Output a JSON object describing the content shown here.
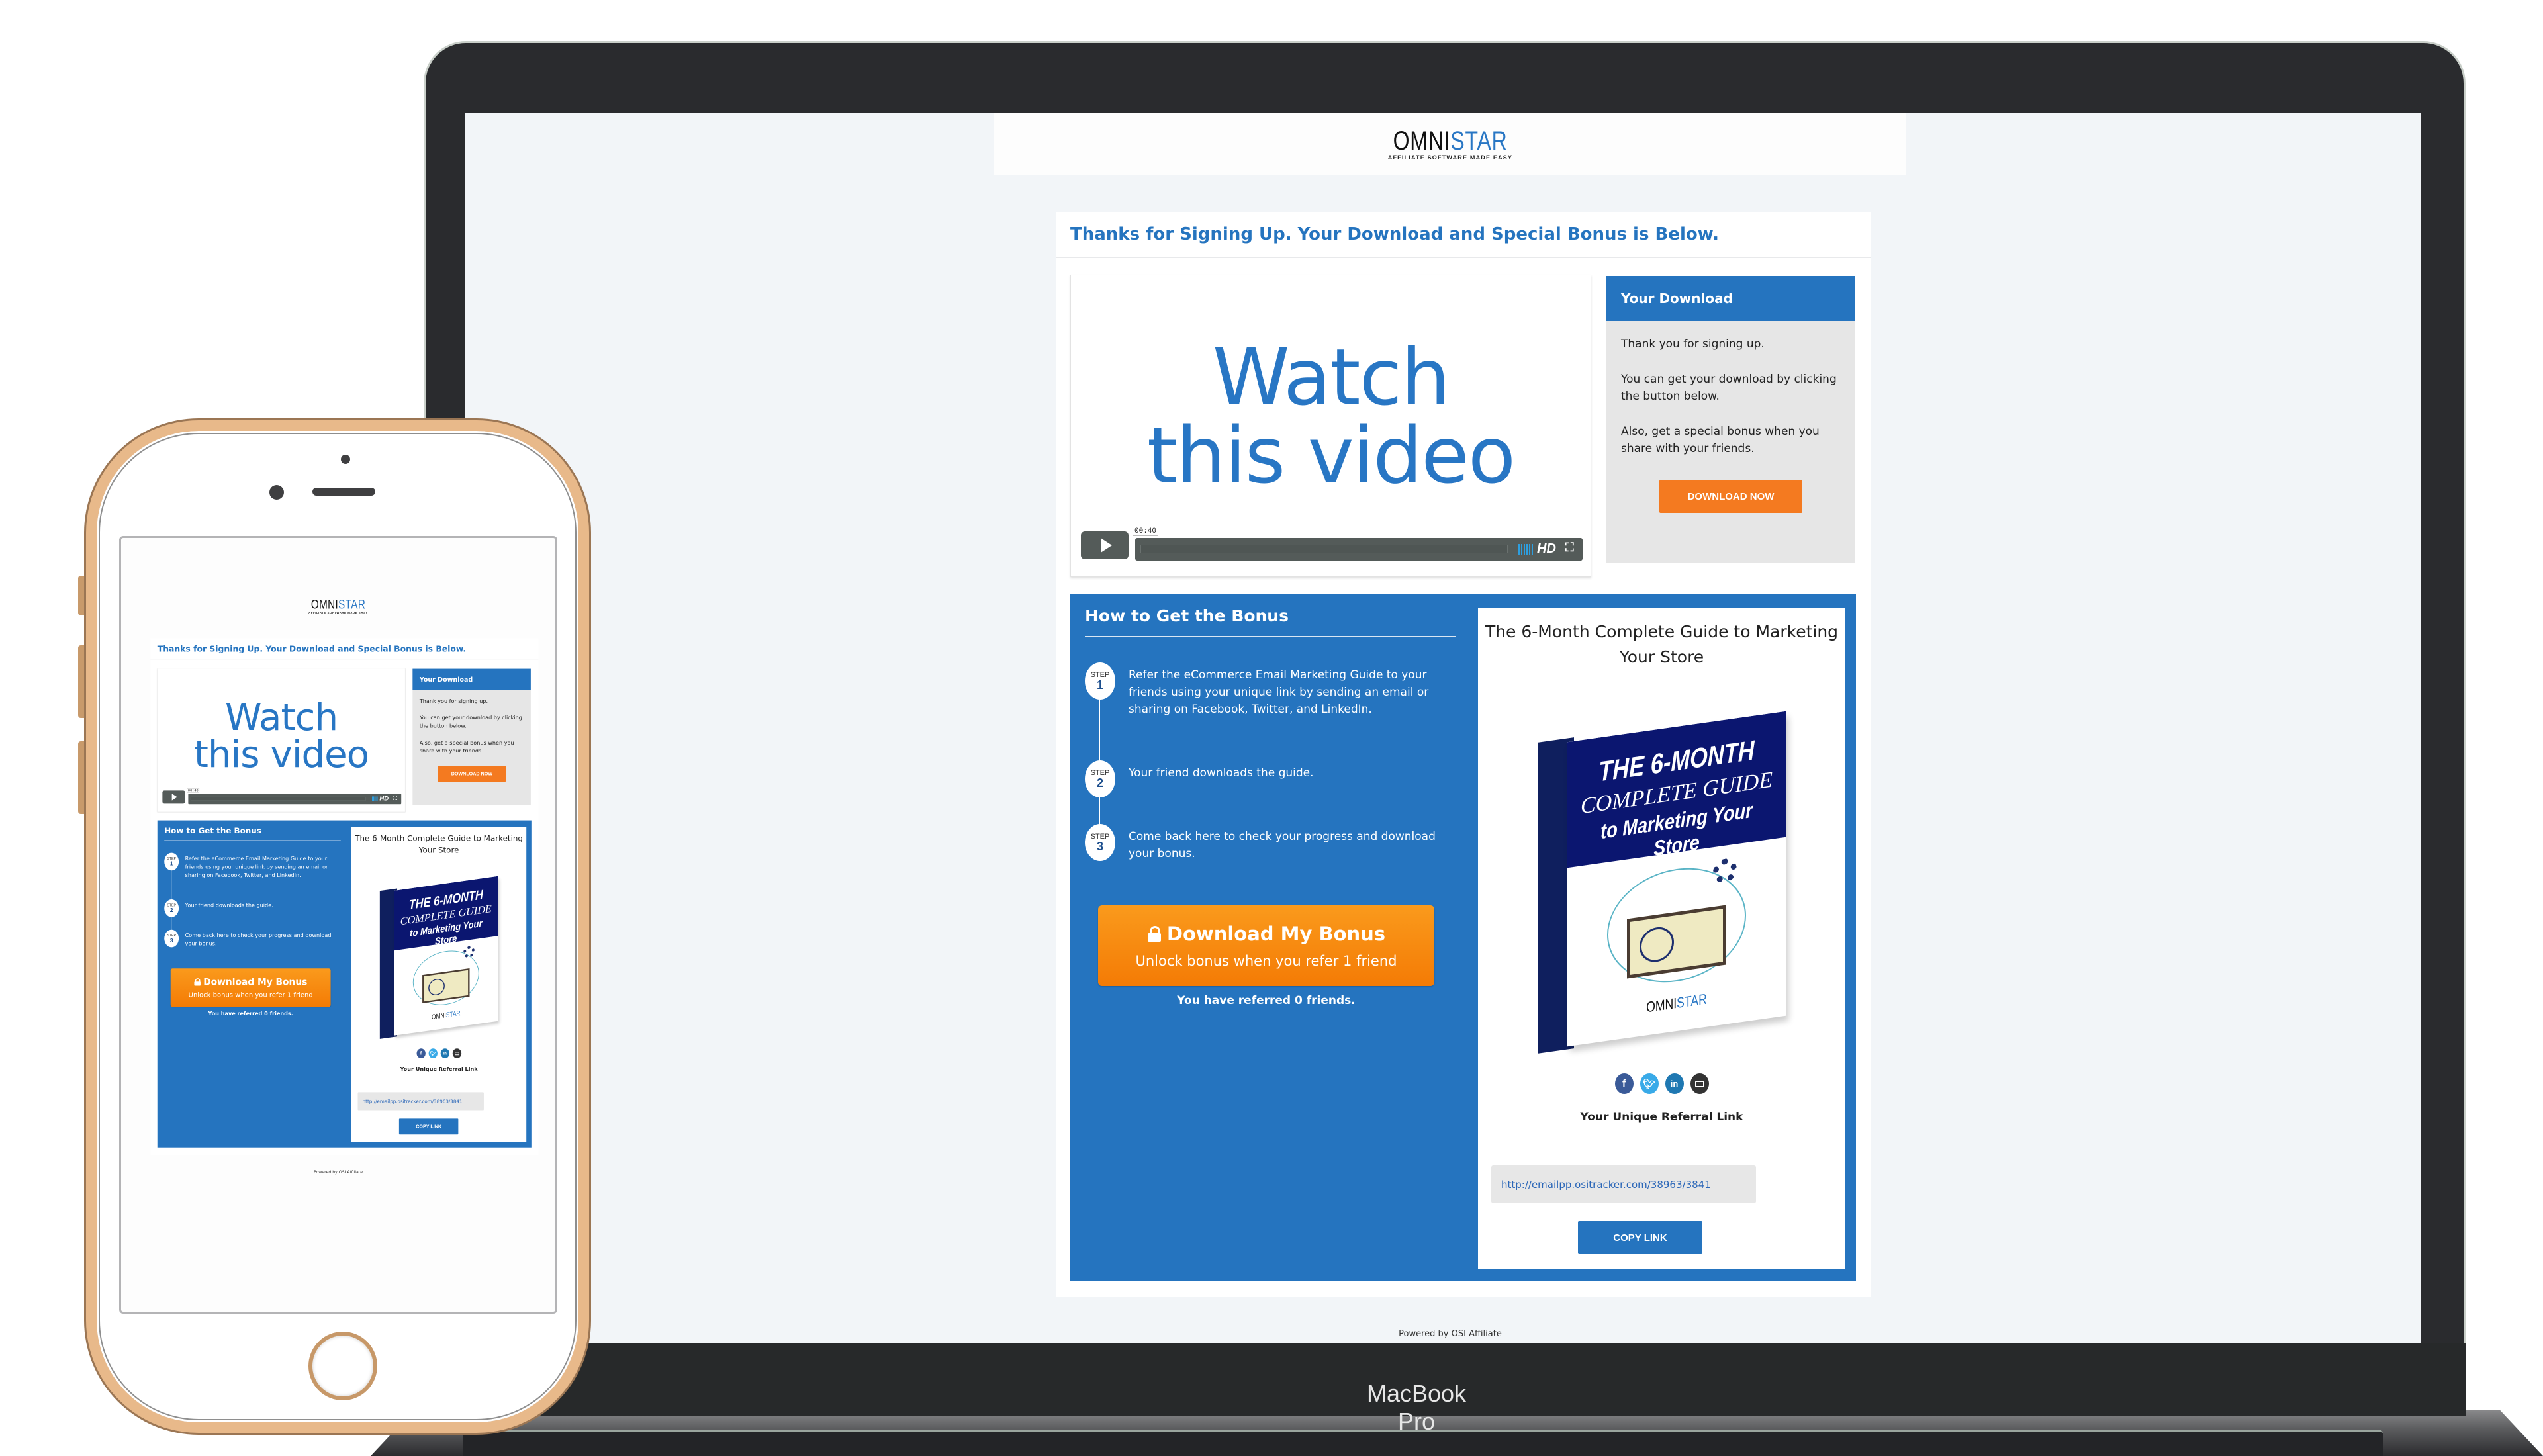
{
  "device": {
    "laptop_label": "MacBook Pro"
  },
  "header": {
    "logo_primary": "OMNI",
    "logo_accent": "STAR",
    "logo_tagline": "AFFILIATE SOFTWARE MADE EASY"
  },
  "page_title": "Thanks for Signing Up. Your Download and Special Bonus is Below.",
  "video": {
    "headline_line1": "Watch",
    "headline_line2": "this video",
    "time": "00:40",
    "quality_label": "HD"
  },
  "download_panel": {
    "title": "Your Download",
    "paragraphs": [
      "Thank you for signing up.",
      "You can get your download by clicking the button below.",
      "Also, get a special bonus when you share with your friends."
    ],
    "button_label": "DOWNLOAD NOW"
  },
  "bonus": {
    "title": "How to Get the Bonus",
    "step_word": "STEP",
    "steps": [
      {
        "number": "1",
        "text": "Refer the eCommerce Email Marketing Guide to your friends using your unique link by sending an email or sharing on Facebook, Twitter, and LinkedIn."
      },
      {
        "number": "2",
        "text": "Your friend downloads the guide."
      },
      {
        "number": "3",
        "text": "Come back here to check your progress and download your bonus."
      }
    ],
    "button_label": "Download My Bonus",
    "button_sublabel": "Unlock bonus when you refer 1 friend",
    "referred_status": "You have referred 0 friends."
  },
  "guide": {
    "title": "The 6-Month Complete Guide to Marketing Your Store",
    "cover_line1": "THE 6-MONTH",
    "cover_line2": "COMPLETE GUIDE",
    "cover_line3": "to Marketing Your Store",
    "cover_logo_primary": "OMNI",
    "cover_logo_accent": "STAR",
    "social": [
      {
        "name": "facebook",
        "glyph": "f"
      },
      {
        "name": "twitter",
        "glyph": "t"
      },
      {
        "name": "linkedin",
        "glyph": "in"
      },
      {
        "name": "email",
        "glyph": ""
      }
    ],
    "referral_label": "Your Unique Referral Link",
    "referral_link": "http://emailpp.ositracker.com/38963/3841",
    "copy_button": "COPY LINK"
  },
  "footer": {
    "powered_by": "Powered by OSI Affiliate"
  },
  "colors": {
    "brand_blue": "#2574bf",
    "cta_orange": "#f47a20",
    "page_bg": "#f2f5f8"
  }
}
